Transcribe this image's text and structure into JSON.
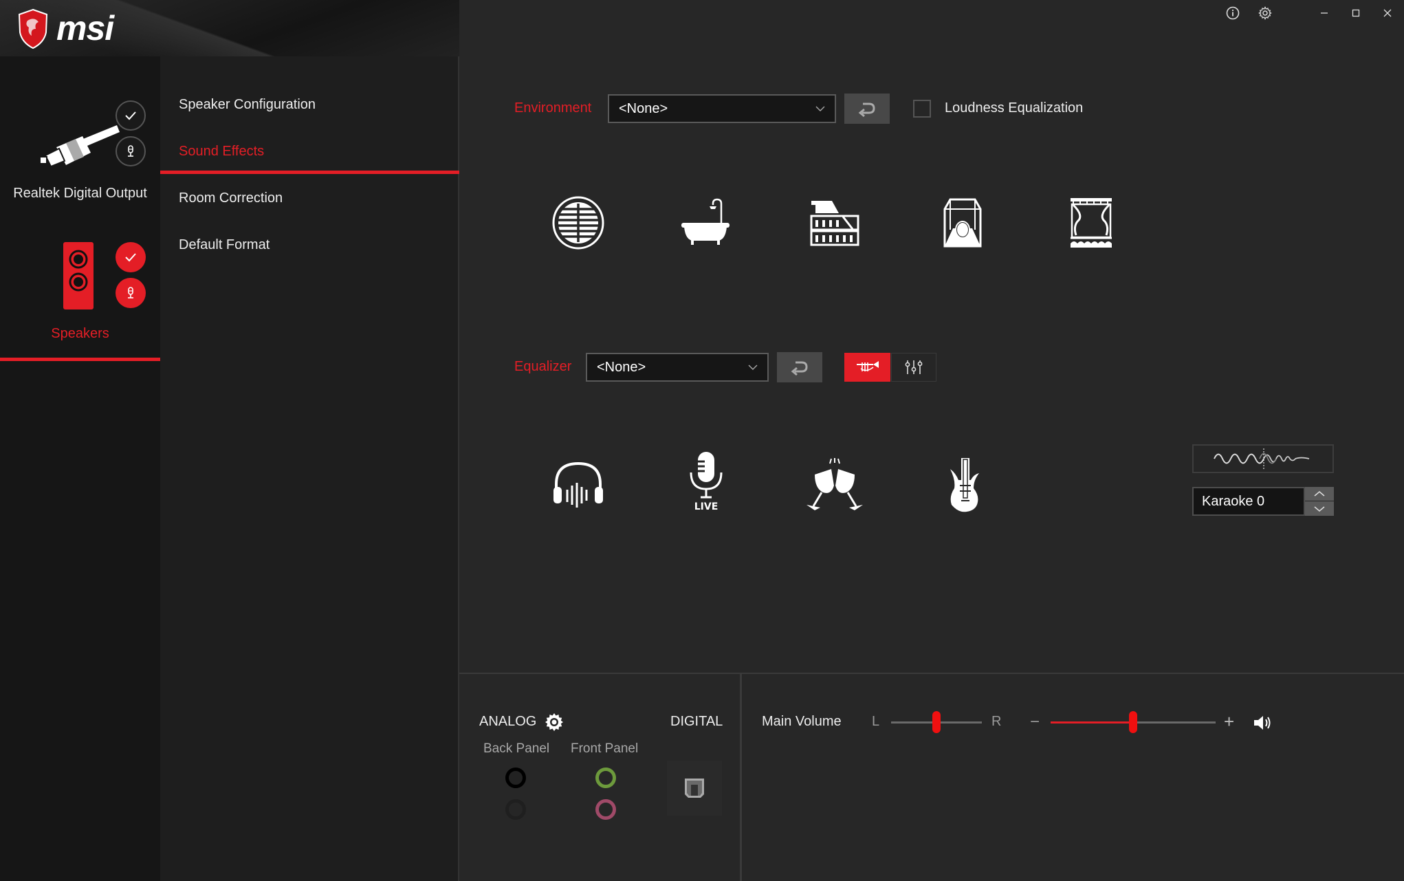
{
  "app": {
    "brand": "msi",
    "accent_color": "#e41e26"
  },
  "titlebar": {
    "info_icon": "info-icon",
    "settings_icon": "gear-icon",
    "minimize_icon": "minimize-icon",
    "maximize_icon": "maximize-icon",
    "close_icon": "close-icon"
  },
  "devices": [
    {
      "label": "Realtek Digital Output",
      "icon": "optical-cable-icon",
      "selected": false,
      "default_check": true,
      "default_comm": true
    },
    {
      "label": "Speakers",
      "icon": "speaker-icon",
      "selected": true,
      "default_check": true,
      "default_comm": true
    }
  ],
  "nav": {
    "items": [
      {
        "label": "Speaker Configuration",
        "active": false
      },
      {
        "label": "Sound Effects",
        "active": true
      },
      {
        "label": "Room Correction",
        "active": false
      },
      {
        "label": "Default Format",
        "active": false
      }
    ]
  },
  "environment": {
    "label": "Environment",
    "selected": "<None>",
    "reset_icon": "reset-icon",
    "loudness_label": "Loudness Equalization",
    "loudness_checked": false,
    "presets": [
      {
        "name": "sewer-pipe",
        "icon": "sewer-pipe-icon"
      },
      {
        "name": "bathroom",
        "icon": "bathtub-icon"
      },
      {
        "name": "colosseum",
        "icon": "colosseum-icon"
      },
      {
        "name": "stone-room",
        "icon": "stone-room-icon"
      },
      {
        "name": "theater",
        "icon": "theater-curtain-icon"
      }
    ]
  },
  "equalizer": {
    "label": "Equalizer",
    "selected": "<None>",
    "reset_icon": "reset-icon",
    "mode_toggle": [
      {
        "name": "preset-mode",
        "icon": "trumpet-icon",
        "active": true
      },
      {
        "name": "graphic-eq-mode",
        "icon": "sliders-icon",
        "active": false
      }
    ],
    "presets": [
      {
        "name": "headphones",
        "icon": "headphones-icon"
      },
      {
        "name": "live",
        "icon": "live-mic-icon",
        "caption": "LIVE"
      },
      {
        "name": "party",
        "icon": "toast-glasses-icon"
      },
      {
        "name": "rock",
        "icon": "guitar-icon"
      }
    ]
  },
  "karaoke": {
    "wave_icon": "voice-wave-icon",
    "value": "Karaoke 0"
  },
  "bottom": {
    "analog_label": "ANALOG",
    "digital_label": "DIGITAL",
    "back_panel_label": "Back Panel",
    "front_panel_label": "Front Panel",
    "back_jacks": [
      {
        "name": "back-jack-black",
        "color": "#000000",
        "active": true
      },
      {
        "name": "back-jack-grey",
        "color": "#2a2a2a",
        "active": false
      }
    ],
    "front_jacks": [
      {
        "name": "front-jack-green",
        "color": "#6d9a3c",
        "active": true
      },
      {
        "name": "front-jack-pink",
        "color": "#a04a68",
        "active": true
      }
    ],
    "main_volume_label": "Main Volume",
    "balance_left": "L",
    "balance_right": "R",
    "balance_value": 0.5,
    "volume_minus": "−",
    "volume_plus": "+",
    "volume_value": 0.5
  }
}
